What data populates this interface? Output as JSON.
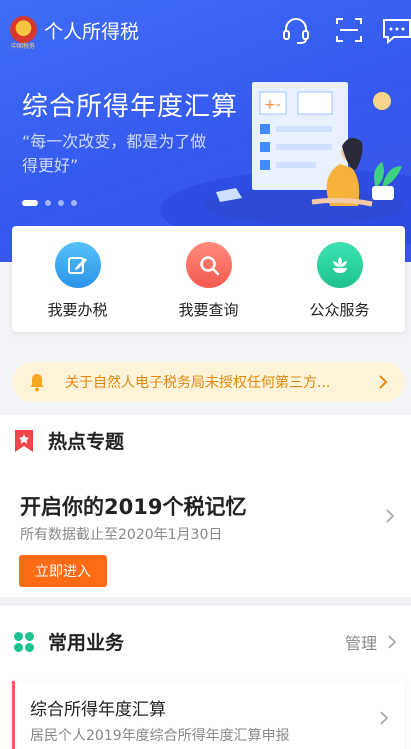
{
  "header": {
    "app_title": "个人所得税",
    "logo_text": "中国税务",
    "icons": [
      "headset-icon",
      "scan-icon",
      "chat-icon"
    ]
  },
  "banner": {
    "title": "综合所得年度汇算",
    "quote": "“每一次改变，都是为了做得更好”",
    "slide_count": 4,
    "active_slide": 1
  },
  "actions": [
    {
      "label": "我要办税",
      "icon": "pencil-icon",
      "color": "#2b93ea"
    },
    {
      "label": "我要查询",
      "icon": "search-icon",
      "color": "#f45a4f"
    },
    {
      "label": "公众服务",
      "icon": "flower-icon",
      "color": "#1dc28f"
    }
  ],
  "notice": {
    "text": "关于自然人电子税务局未授权任何第三方..."
  },
  "hot_topics": {
    "section_title": "热点专题",
    "item_title": "开启你的2019个税记忆",
    "item_subtitle": "所有数据截止至2020年1月30日",
    "button_label": "立即进入"
  },
  "common_business": {
    "section_title": "常用业务",
    "manage_label": "管理",
    "items": [
      {
        "title": "综合所得年度汇算",
        "subtitle": "居民个人2019年度综合所得年度汇算申报"
      }
    ]
  },
  "colors": {
    "banner_blue": "#3f6cf6",
    "accent_orange": "#ff6a14",
    "notice_bg": "#fdf3d9",
    "notice_text": "#e2880e"
  }
}
